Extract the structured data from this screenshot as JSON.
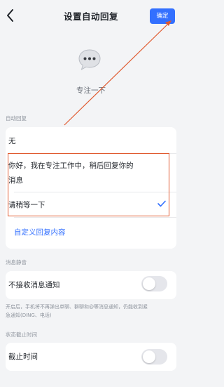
{
  "header": {
    "title": "设置自动回复",
    "confirm_label": "确定"
  },
  "status": {
    "icon": "speech-bubble-ellipsis-icon",
    "label": "专注一下"
  },
  "auto_reply": {
    "section_label": "自动回复",
    "options": [
      {
        "label": "无",
        "selected": false
      },
      {
        "label": "你好，我在专注工作中，稍后回复你的消息",
        "line1": "你好，我在专注工作中，稍后回复你的",
        "line2": "消息",
        "selected": false
      },
      {
        "label": "请稍等一下",
        "selected": true
      }
    ],
    "custom_link": "自定义回复内容"
  },
  "mute": {
    "section_label": "消息静音",
    "item_label": "不接收消息通知",
    "enabled": false,
    "note_line1": "开启后，手机将不再弹出单聊、群聊和@等消息通知，仍能收到紧",
    "note_line2": "急通知(DING、电话)"
  },
  "expiry": {
    "section_label": "状态截止时间",
    "item_label": "截止时间",
    "enabled": false
  },
  "colors": {
    "accent": "#3370ff",
    "annotation": "#e0592e",
    "background": "#f3f4f6"
  }
}
